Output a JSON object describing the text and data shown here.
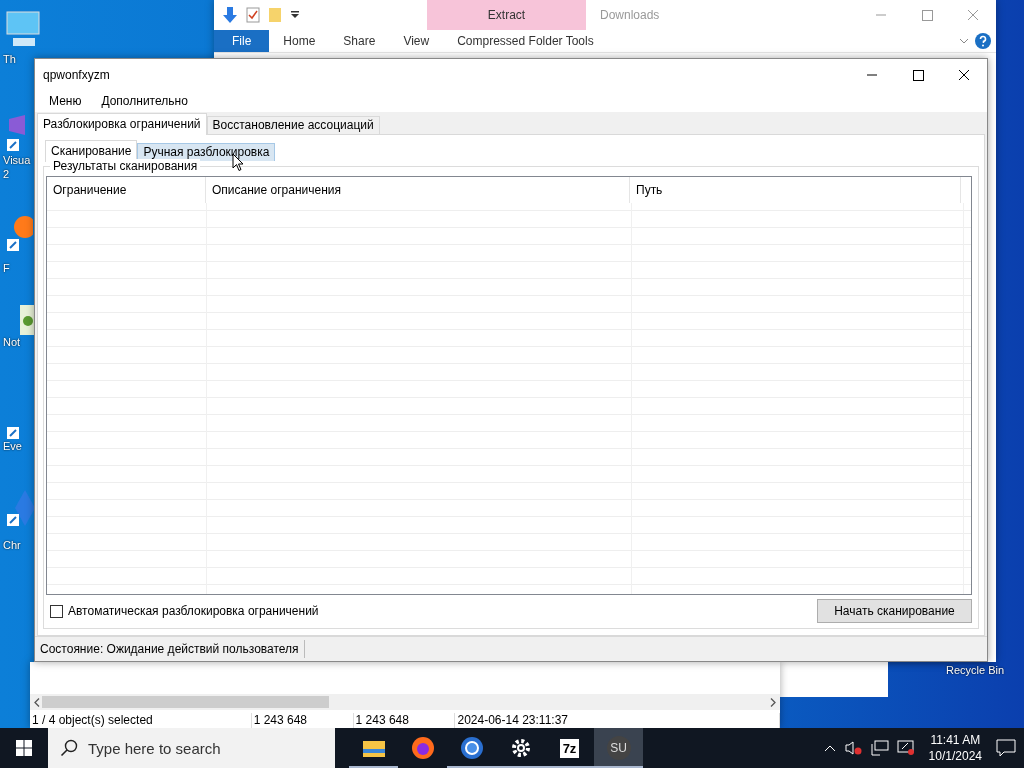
{
  "desktop": {
    "icons": [
      {
        "kind": "pc",
        "label": "Th"
      },
      {
        "kind": "studio",
        "label": "Visua\n2"
      },
      {
        "kind": "browser",
        "label": "F"
      },
      {
        "kind": "notepad",
        "label": "Not"
      },
      {
        "kind": "search",
        "label": "Eve"
      },
      {
        "kind": "chrome",
        "label": "Chr"
      }
    ],
    "recycle_bin": "Recycle Bin"
  },
  "explorer": {
    "title": "Downloads",
    "context_group": "Extract",
    "file_tab": "File",
    "tabs": [
      "Home",
      "Share",
      "View"
    ],
    "context_tab": "Compressed Folder Tools"
  },
  "file_manager": {
    "status": [
      "1 / 4 object(s) selected",
      "1 243 648",
      "1 243 648",
      "2024-06-14 23:11:37"
    ]
  },
  "app": {
    "title": "qpwonfxyzm",
    "menu": [
      "Меню",
      "Дополнительно"
    ],
    "tabs": [
      {
        "label": "Разблокировка ограничений",
        "selected": true
      },
      {
        "label": "Восстановление ассоциаций",
        "selected": false
      }
    ],
    "subtabs": [
      {
        "label": "Сканирование",
        "selected": true,
        "hovered": false
      },
      {
        "label": "Ручная разблокировка",
        "selected": false,
        "hovered": true
      }
    ],
    "group_title": "Результаты сканирования",
    "columns": [
      "Ограничение",
      "Описание ограничения",
      "Путь"
    ],
    "auto_unlock": {
      "label": "Автоматическая разблокировка ограничений",
      "checked": false
    },
    "scan_button": "Начать сканирование",
    "status": "Состояние: Ожидание действий пользователя"
  },
  "taskbar": {
    "search_placeholder": "Type here to search",
    "apps": [
      {
        "kind": "folder",
        "running": true,
        "active": false
      },
      {
        "kind": "firefox",
        "running": false,
        "active": false
      },
      {
        "kind": "chrome",
        "running": true,
        "active": false
      },
      {
        "kind": "settings",
        "running": true,
        "active": false
      },
      {
        "kind": "text",
        "label": "7z",
        "running": true,
        "active": false
      },
      {
        "kind": "round",
        "label": "SU",
        "running": true,
        "active": true
      }
    ],
    "time": "11:41 AM",
    "date": "10/1/2024"
  }
}
